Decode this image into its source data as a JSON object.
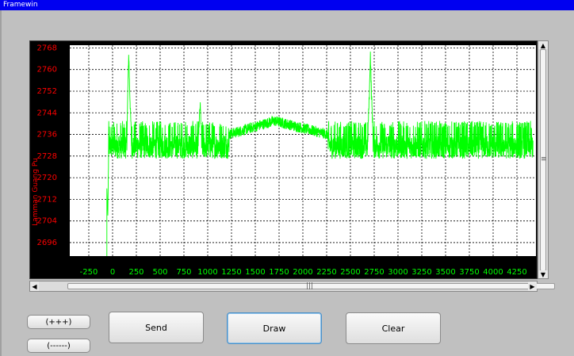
{
  "window": {
    "title": "Framewin"
  },
  "chart_data": {
    "type": "line",
    "ylabel": "Lamman Guang Pu",
    "yticks": [
      2768,
      2760,
      2752,
      2744,
      2736,
      2728,
      2720,
      2712,
      2704,
      2696
    ],
    "xticks": [
      -250,
      0,
      250,
      500,
      750,
      1000,
      1250,
      1500,
      1750,
      2000,
      2250,
      2500,
      2750,
      3000,
      3250,
      3500,
      3750,
      4000,
      4250
    ],
    "xlim": [
      -450,
      4450
    ],
    "ylim": [
      2691,
      2769
    ],
    "grid": true,
    "series": [
      {
        "color": "#00ff00",
        "baseline": 2732,
        "noise_range": [
          2722,
          2741
        ],
        "x": [
          -60,
          -60,
          -50,
          -40,
          0,
          150,
          160,
          170,
          180,
          200,
          900,
          920,
          940,
          1700,
          2600,
          2680,
          2700,
          2710,
          2720,
          2740,
          2760,
          3500,
          4000,
          4420
        ],
        "y": [
          2691,
          2716,
          2706,
          2734,
          2733,
          2733,
          2752,
          2766,
          2752,
          2733,
          2733,
          2747,
          2733,
          2741,
          2733,
          2733,
          2752,
          2766,
          2752,
          2734,
          2733,
          2733,
          2736,
          2733
        ]
      }
    ]
  },
  "buttons": {
    "zoom_in": "(+++)",
    "zoom_out": "(------)",
    "send": "Send",
    "draw": "Draw",
    "clear": "Clear"
  },
  "colors": {
    "title_bar": "#0000f0",
    "plot_bg": "#000000",
    "grid": "#ffffff",
    "axis_text_y": "#ff0000",
    "axis_text_x": "#00ff00"
  },
  "icons": {
    "scroll_up": "up-arrow-icon",
    "scroll_down": "down-arrow-icon",
    "scroll_left": "left-arrow-icon",
    "scroll_right": "right-arrow-icon",
    "grip": "grip-icon"
  }
}
